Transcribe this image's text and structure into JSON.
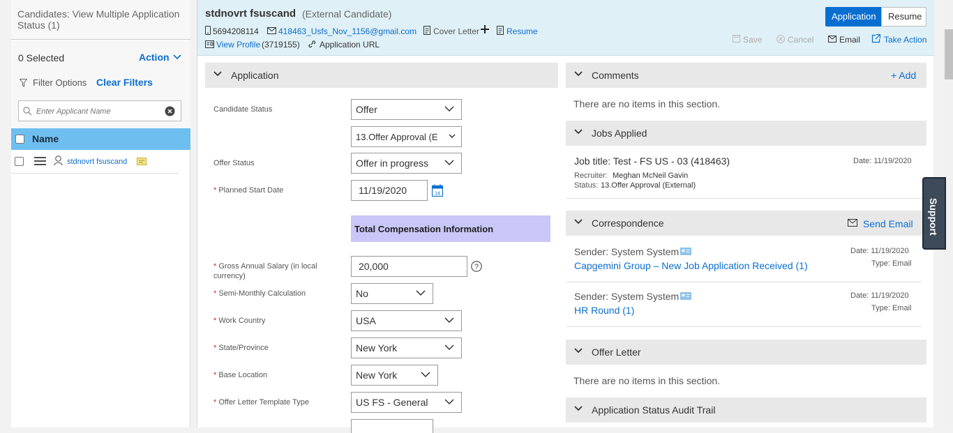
{
  "left": {
    "title": "Candidates: View Multiple Application Status (1)",
    "selected": "0 Selected",
    "action_label": "Action",
    "filter_options": "Filter Options",
    "clear_filters": "Clear Filters",
    "search_placeholder": "Enter Applicant Name",
    "name_header": "Name",
    "candidate": "stdnovrt fsuscand"
  },
  "header": {
    "name": "stdnovrt fsuscand",
    "type": "(External Candidate)",
    "phone": "5694208114",
    "email": "418463_Usfs_Nov_1156@gmail.com",
    "cover_letter": "Cover Letter",
    "resume_link": "Resume",
    "view_profile": "View Profile",
    "profile_id": "(3719155)",
    "application_url": "Application URL",
    "tab_application": "Application",
    "tab_resume": "Resume",
    "save": "Save",
    "cancel": "Cancel",
    "email_action": "Email",
    "take_action": "Take Action"
  },
  "application": {
    "section_title": "Application",
    "candidate_status_label": "Candidate Status",
    "candidate_status_value": "Offer",
    "sub_status_value": "13.Offer Approval (E",
    "offer_status_label": "Offer Status",
    "offer_status_value": "Offer in progress",
    "planned_start_label": "Planned Start Date",
    "planned_start_value": "11/19/2020",
    "calendar_day": "14",
    "total_comp_header": "Total Compensation Information",
    "gross_salary_label": "Gross Annual Salary (in local currency)",
    "gross_salary_value": "20,000",
    "semi_monthly_label": "Semi-Monthly Calculation",
    "semi_monthly_value": "No",
    "work_country_label": "Work Country",
    "work_country_value": "USA",
    "state_label": "State/Province",
    "state_value": "New York",
    "base_location_label": "Base Location",
    "base_location_value": "New York",
    "offer_template_label": "Offer Letter Template Type",
    "offer_template_value": "US FS - General"
  },
  "right": {
    "comments_title": "Comments",
    "add_label": "+ Add",
    "no_items": "There are no items in this section.",
    "jobs_applied_title": "Jobs Applied",
    "job_title": "Job title: Test - FS US - 03 (418463)",
    "job_date": "Date: 11/19/2020",
    "recruiter_label": "Recruiter:",
    "recruiter_name": "Meghan McNeil Gavin",
    "status_label": "Status:",
    "status_value": "13.Offer Approval (External)",
    "correspondence_title": "Correspondence",
    "send_email": "Send Email",
    "corr": [
      {
        "sender": "Sender: System System",
        "subject": "Capgemini Group – New Job Application Received (1)",
        "date": "Date: 11/19/2020",
        "type": "Type: Email"
      },
      {
        "sender": "Sender: System System",
        "subject": "HR Round (1)",
        "date": "Date: 11/19/2020",
        "type": "Type: Email"
      }
    ],
    "offer_letter_title": "Offer Letter",
    "no_items_offer": "There are no items in this section.",
    "audit_title": "Application Status Audit Trail"
  },
  "support": "Support"
}
